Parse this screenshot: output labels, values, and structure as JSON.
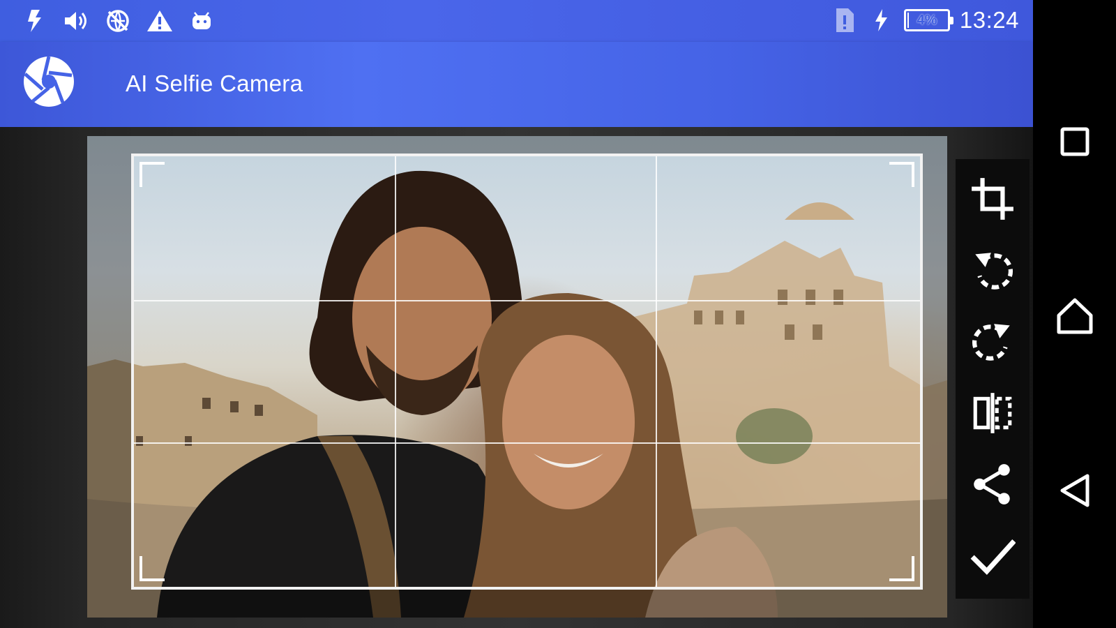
{
  "status_bar": {
    "time": "13:24",
    "battery_text": "4%",
    "battery_level_percent": 4,
    "left_icons": [
      "flash-bolt-icon",
      "volume-icon",
      "network-blocked-icon",
      "warning-icon",
      "android-icon"
    ],
    "right_icons": [
      "sim-alert-icon",
      "charging-icon",
      "battery-icon"
    ],
    "color": "#3f5ee0"
  },
  "app_bar": {
    "title": "AI Selfie Camera",
    "logo_icon": "camera-shutter-icon",
    "color": "#4f70f2"
  },
  "crop_view": {
    "image_description_icon": "selfie-photo",
    "grid": "rule-of-thirds",
    "frame_color": "#ffffff"
  },
  "toolbar": {
    "items": [
      {
        "name": "crop",
        "icon": "crop-icon"
      },
      {
        "name": "rotate-left",
        "icon": "rotate-left-icon"
      },
      {
        "name": "rotate-right",
        "icon": "rotate-right-icon"
      },
      {
        "name": "flip",
        "icon": "flip-icon"
      },
      {
        "name": "share",
        "icon": "share-icon"
      },
      {
        "name": "confirm",
        "icon": "checkmark-icon"
      }
    ],
    "background": "#0c0c0c"
  },
  "nav_bar": {
    "buttons": [
      "recents-icon",
      "home-icon",
      "back-icon"
    ]
  }
}
